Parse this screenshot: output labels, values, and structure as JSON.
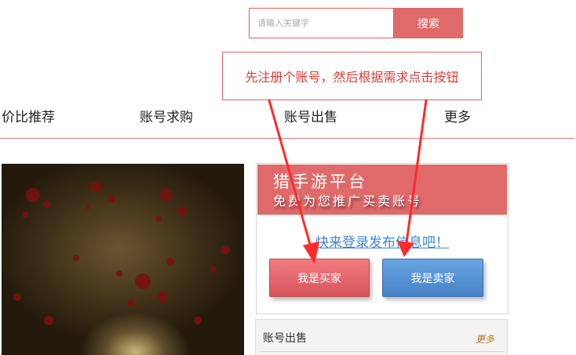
{
  "search": {
    "placeholder": "请输入关键字",
    "button_label": "搜索"
  },
  "annotation": {
    "text": "先注册个账号，然后根据需求点击按钮",
    "color": "#e23a3a"
  },
  "nav": {
    "items": [
      {
        "label": "价比推荐"
      },
      {
        "label": "账号求购"
      },
      {
        "label": "账号出售"
      },
      {
        "label": "更多"
      }
    ]
  },
  "promo": {
    "title": "猎手游平台",
    "subtitle": "免费为您推广买卖账号",
    "login_prompt": "快来登录发布信息吧！",
    "buyer_button": "我是买家",
    "seller_button": "我是卖家"
  },
  "account_section": {
    "title": "账号出售",
    "more": "更多"
  },
  "colors": {
    "accent": "#e06a6a",
    "link": "#3f86d6",
    "seller_blue": "#4a88cc"
  }
}
